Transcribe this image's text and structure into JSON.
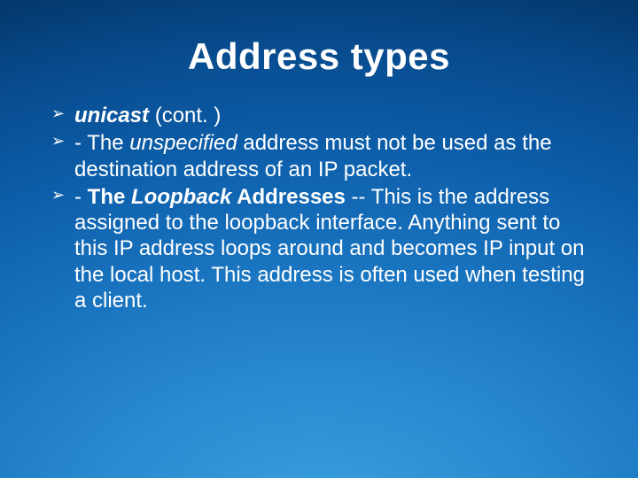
{
  "slide": {
    "title": "Address types",
    "bullets": [
      {
        "prefix_bi": "unicast",
        "rest": "  (cont. )"
      },
      {
        "lead": " - The ",
        "em": "unspecified",
        "rest": " address must not be used as the destination address of an IP packet."
      },
      {
        "lead": " - ",
        "strong1": "The ",
        "strong_em": "Loopback",
        "strong2": " Addresses",
        "rest": " -- This is the address assigned to the loopback interface. Anything sent to this IP address loops around and becomes IP input on the local host. This address is often used when testing a client."
      }
    ]
  }
}
